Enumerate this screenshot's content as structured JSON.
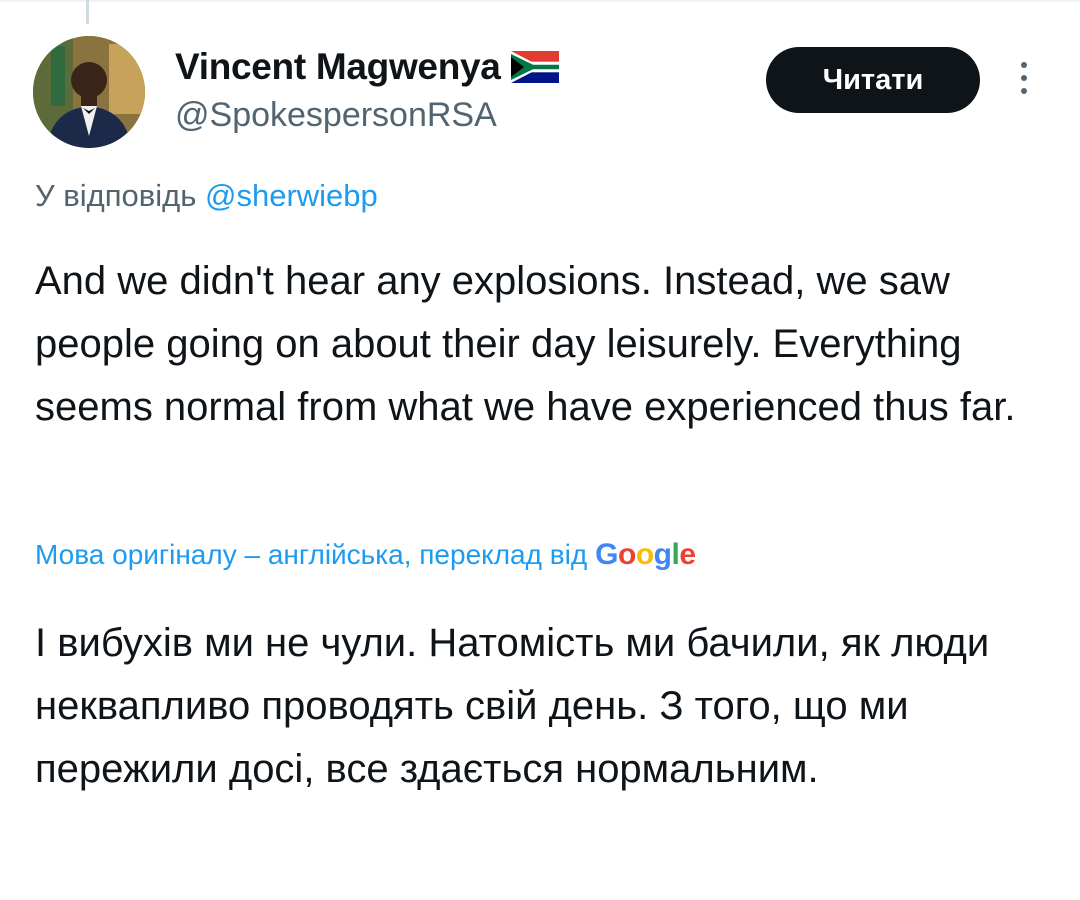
{
  "author": {
    "display_name": "Vincent Magwenya",
    "handle": "@SpokespersonRSA",
    "flag_icon": "south-africa-flag-icon"
  },
  "follow_button": {
    "label": "Читати"
  },
  "reply": {
    "prefix": "У відповідь ",
    "mention": "@sherwiebp"
  },
  "tweet": {
    "text": "And we didn't hear any explosions. Instead, we saw people going on about their day leisurely. Everything seems normal from what we have experienced thus far."
  },
  "translation": {
    "note": "Мова оригіналу – англійська, переклад від",
    "provider_parts": [
      "G",
      "o",
      "o",
      "g",
      "l",
      "e"
    ],
    "text": "І вибухів ми не чули. Натомість ми бачили, як люди неквапливо проводять свій день. З того, що ми пережили досі, все здається нормальним."
  },
  "colors": {
    "link": "#1d9bf0",
    "secondary_text": "#536471",
    "button_bg": "#0f1419"
  }
}
